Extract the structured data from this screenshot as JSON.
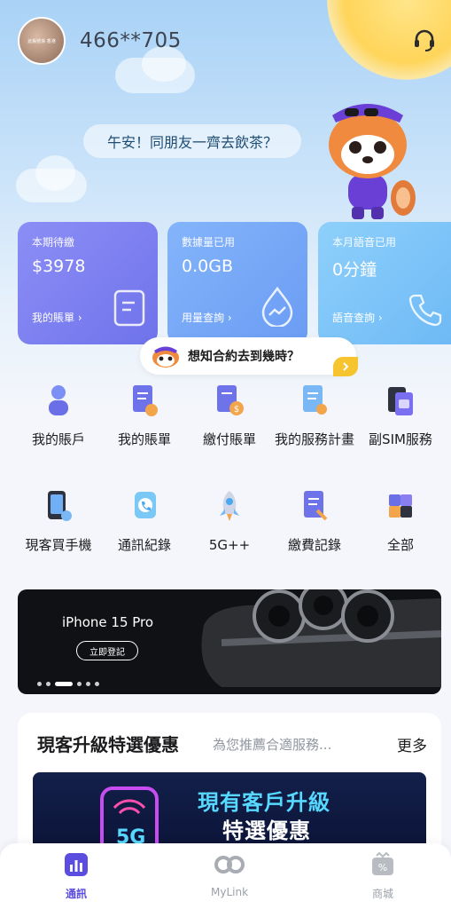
{
  "header": {
    "avatar_text": "此帳號係 香港",
    "account_number": "466**705"
  },
  "greeting": "午安！同朋友一齊去飲茶？",
  "stat_cards": [
    {
      "label": "本期待繳",
      "value": "$3978",
      "link": "我的賬單 ›",
      "icon": "bill-icon"
    },
    {
      "label": "數據量已用",
      "value": "0.0GB",
      "link": "用量查詢 ›",
      "icon": "data-drop-icon"
    },
    {
      "label": "本月語音已用",
      "value": "0分鐘",
      "link": "語音查詢 ›",
      "icon": "phone-icon"
    }
  ],
  "contract_prompt": "想知合約去到幾時？",
  "services": [
    {
      "label": "我的賬戶",
      "icon": "account-icon"
    },
    {
      "label": "我的賬單",
      "icon": "bill-doc-icon"
    },
    {
      "label": "繳付賬單",
      "icon": "pay-bill-icon"
    },
    {
      "label": "我的服務計畫",
      "icon": "service-plan-icon"
    },
    {
      "label": "副SIM服務",
      "icon": "sim-icon"
    },
    {
      "label": "現客買手機",
      "icon": "phone-purchase-icon"
    },
    {
      "label": "通訊紀錄",
      "icon": "call-log-icon"
    },
    {
      "label": "5G++",
      "icon": "rocket-icon"
    },
    {
      "label": "繳費記錄",
      "icon": "payment-record-icon"
    },
    {
      "label": "全部",
      "icon": "all-services-icon"
    }
  ],
  "banner": {
    "title": "iPhone 15 Pro",
    "button": "立即登記"
  },
  "promo": {
    "title": "現客升級特選優惠",
    "subtitle": "為您推薦合適服務...",
    "more": "更多",
    "banner_line1": "現有客戶升級",
    "banner_line2": "特選優惠",
    "banner_badge": "5G"
  },
  "tabs": [
    {
      "label": "通訊",
      "icon": "chart-bars-icon",
      "active": true
    },
    {
      "label": "MyLink",
      "icon": "mylink-icon",
      "active": false
    },
    {
      "label": "商城",
      "icon": "shop-icon",
      "active": false
    }
  ],
  "colors": {
    "accent": "#5b4de0",
    "card_bill": "#7c7ff0",
    "card_data": "#78a8f7",
    "card_voice": "#7cc4f8",
    "promo_highlight": "#57d8ff"
  }
}
